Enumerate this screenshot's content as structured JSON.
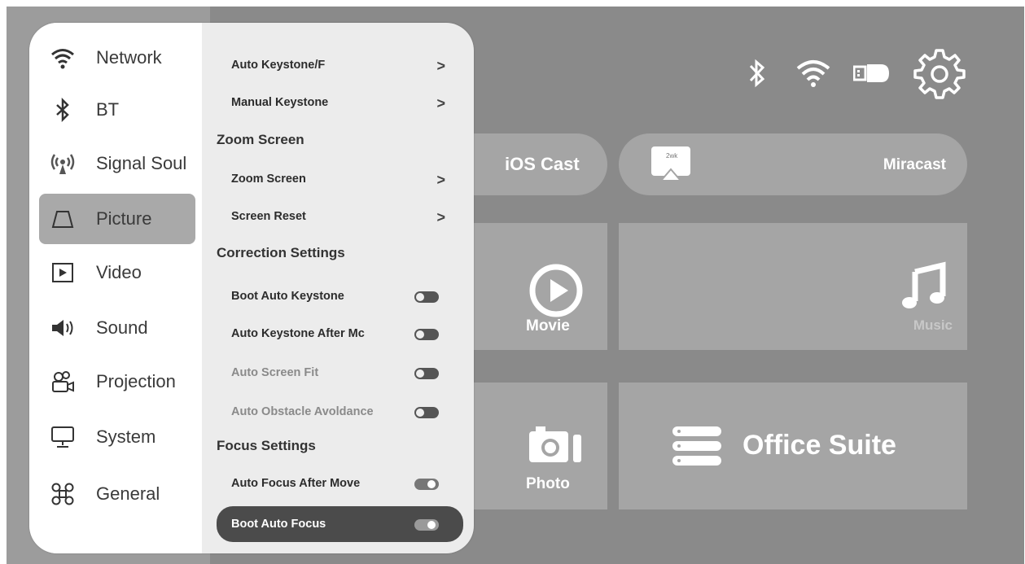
{
  "categories": [
    {
      "label": "Network",
      "icon": "wifi-icon"
    },
    {
      "label": "BT",
      "icon": "bluetooth-icon"
    },
    {
      "label": "Signal Soul",
      "icon": "signal-source-icon"
    },
    {
      "label": "Picture",
      "icon": "picture-icon",
      "active": true
    },
    {
      "label": "Video",
      "icon": "video-icon"
    },
    {
      "label": "Sound",
      "icon": "sound-icon"
    },
    {
      "label": "Projection",
      "icon": "projection-icon"
    },
    {
      "label": "System",
      "icon": "system-icon"
    },
    {
      "label": "General",
      "icon": "general-icon"
    }
  ],
  "options": {
    "auto_keystone_f": "Auto Keystone/F",
    "manual_keystone": "Manual Keystone",
    "zoom_section": "Zoom Screen",
    "zoom_screen": "Zoom Screen",
    "screen_reset": "Screen Reset",
    "correction_section": "Correction Settings",
    "boot_auto_keystone": "Boot Auto Keystone",
    "auto_keystone_after_move": "Auto Keystone After Mc",
    "auto_screen_fit": "Auto Screen Fit",
    "auto_obstacle_avoidance": "Auto Obstacle Avoldance",
    "focus_section": "Focus Settings",
    "auto_focus_after_move": "Auto Focus After Move",
    "boot_auto_focus": "Boot Auto Focus",
    "chevron": ">"
  },
  "tiles": {
    "ios_cast": "iOS Cast",
    "miracast": "Miracast",
    "movie": "Movie",
    "music": "Music",
    "photo": "Photo",
    "office_suite": "Office Suite"
  },
  "colors": {
    "background": "#8a8a8a",
    "tile": "#a5a5a5",
    "panel": "#ececec",
    "selected_row": "#4b4b4b"
  }
}
